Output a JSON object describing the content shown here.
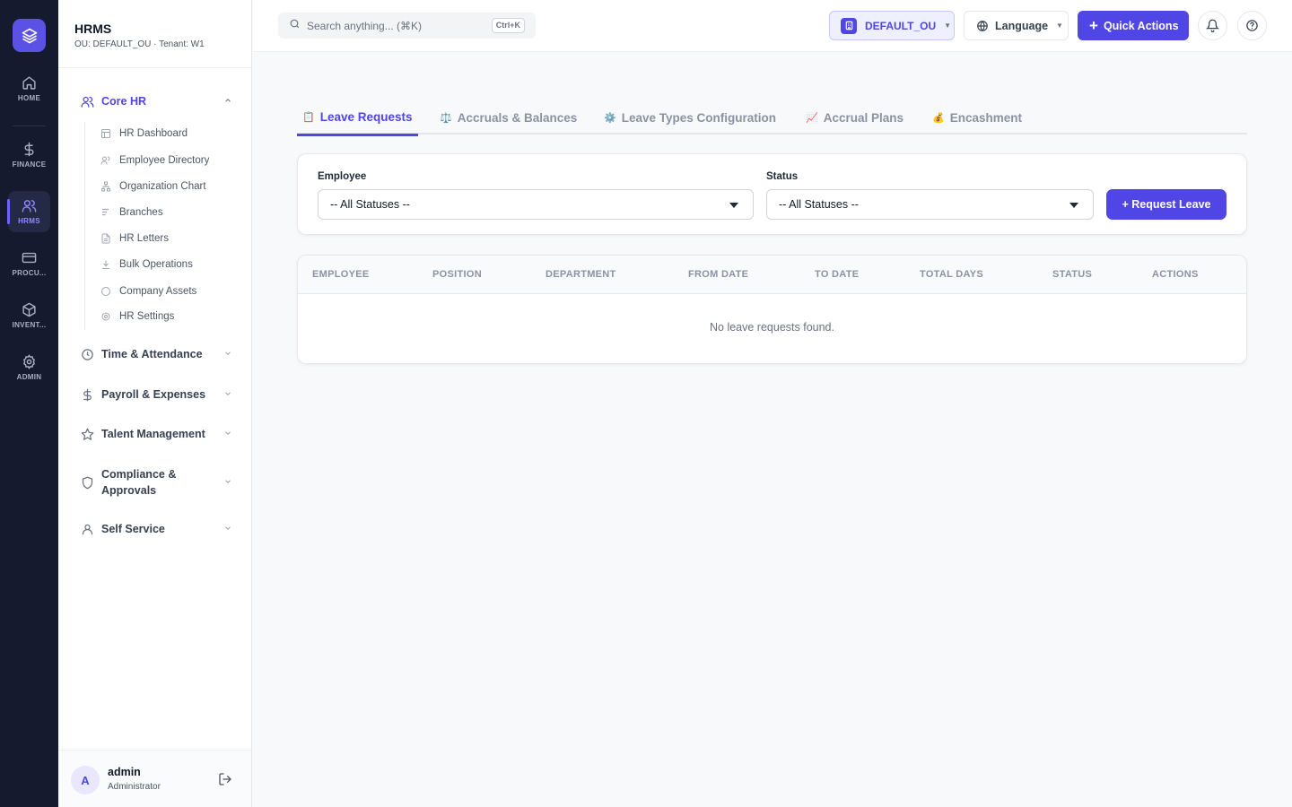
{
  "rail": {
    "items": [
      {
        "key": "home",
        "label": "HOME"
      },
      {
        "key": "finance",
        "label": "FINANCE"
      },
      {
        "key": "hrms",
        "label": "HRMS"
      },
      {
        "key": "procurement",
        "label": "PROCU..."
      },
      {
        "key": "inventory",
        "label": "INVENT..."
      },
      {
        "key": "admin",
        "label": "ADMIN"
      }
    ],
    "active": "hrms"
  },
  "sidebar": {
    "title": "HRMS",
    "subtitle": "OU: DEFAULT_OU · Tenant: W1",
    "groups": {
      "core_hr": "Core HR",
      "time_attendance": "Time & Attendance",
      "payroll": "Payroll & Expenses",
      "talent": "Talent Management",
      "compliance_1": "Compliance &",
      "compliance_2": "Approvals",
      "self_service": "Self Service"
    },
    "core_hr_items": [
      {
        "label": "HR Dashboard",
        "icon": "grid-icon"
      },
      {
        "label": "Employee Directory",
        "icon": "users-icon"
      },
      {
        "label": "Organization Chart",
        "icon": "org-chart-icon"
      },
      {
        "label": "Branches",
        "icon": "branch-icon"
      },
      {
        "label": "HR Letters",
        "icon": "document-icon"
      },
      {
        "label": "Bulk Operations",
        "icon": "download-icon"
      },
      {
        "label": "Company Assets",
        "icon": "circle-icon"
      },
      {
        "label": "HR Settings",
        "icon": "gear-icon"
      }
    ],
    "user": {
      "initial": "A",
      "name": "admin",
      "role": "Administrator"
    }
  },
  "topbar": {
    "search_placeholder": "Search anything... (⌘K)",
    "search_shortcut": "Ctrl+K",
    "ou_label": "DEFAULT_OU",
    "language_label": "Language",
    "quick_actions_label": "Quick Actions"
  },
  "tabs": [
    {
      "emoji": "📋",
      "label": "Leave Requests"
    },
    {
      "emoji": "⚖️",
      "label": "Accruals & Balances"
    },
    {
      "emoji": "⚙️",
      "label": "Leave Types Configuration"
    },
    {
      "emoji": "📈",
      "label": "Accrual Plans"
    },
    {
      "emoji": "💰",
      "label": "Encashment"
    }
  ],
  "filters": {
    "employee_label": "Employee",
    "employee_value": "-- All Statuses --",
    "status_label": "Status",
    "status_value": "-- All Statuses --",
    "request_button": "+ Request Leave"
  },
  "table": {
    "columns": [
      "EMPLOYEE",
      "POSITION",
      "DEPARTMENT",
      "FROM DATE",
      "TO DATE",
      "TOTAL DAYS",
      "STATUS",
      "ACTIONS"
    ],
    "empty_message": "No leave requests found."
  },
  "colors": {
    "accent": "#4f46e5",
    "rail_bg": "#151a2e",
    "page_bg": "#f8f9fb"
  }
}
